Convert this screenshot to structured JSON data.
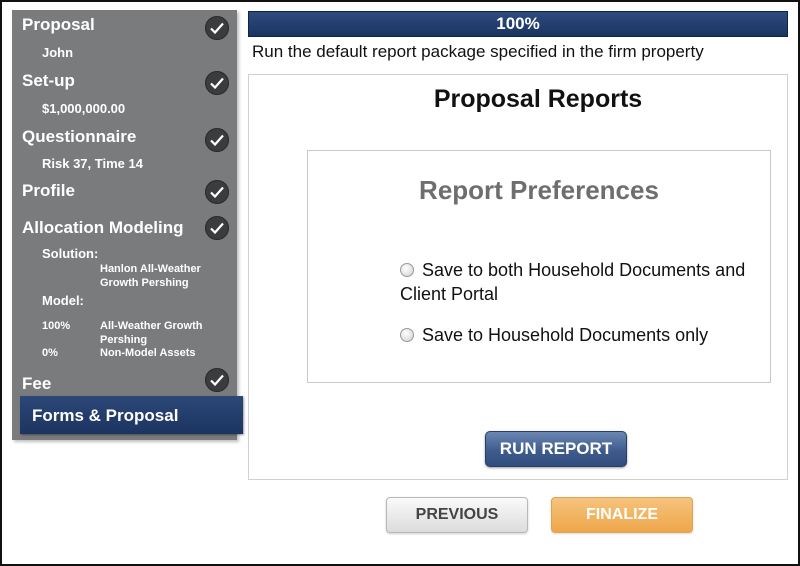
{
  "sidebar": {
    "steps": [
      {
        "label": "Proposal",
        "detail": "John",
        "complete": true
      },
      {
        "label": "Set-up",
        "detail": "$1,000,000.00",
        "complete": true
      },
      {
        "label": "Questionnaire",
        "detail": "Risk 37, Time 14",
        "complete": true
      },
      {
        "label": "Profile",
        "complete": true
      },
      {
        "label": "Allocation Modeling",
        "complete": true
      },
      {
        "label": "Fee",
        "complete": true
      }
    ],
    "allocation": {
      "solution_label": "Solution:",
      "solution_value": "Hanlon All-Weather Growth Pershing",
      "model_label": "Model:",
      "models": [
        {
          "pct": "100%",
          "name": "All-Weather Growth Pershing"
        },
        {
          "pct": "0%",
          "name": "Non-Model Assets"
        }
      ]
    },
    "active_step": "Forms & Proposal"
  },
  "progress": {
    "value": 100,
    "label": "100%"
  },
  "description": "Run the default report package specified in the firm property",
  "content": {
    "title": "Proposal Reports",
    "preferences": {
      "title": "Report Preferences",
      "options": [
        {
          "label": "Save to both Household Documents and Client Portal",
          "selected": false
        },
        {
          "label": "Save to Household Documents only",
          "selected": false
        }
      ]
    },
    "run_button": "RUN REPORT"
  },
  "nav": {
    "previous": "PREVIOUS",
    "finalize": "FINALIZE"
  },
  "colors": {
    "sidebar": "#7a7b7d",
    "active": "#1f3a66",
    "progress": "#1e3a66",
    "finalize": "#f0a94f"
  }
}
